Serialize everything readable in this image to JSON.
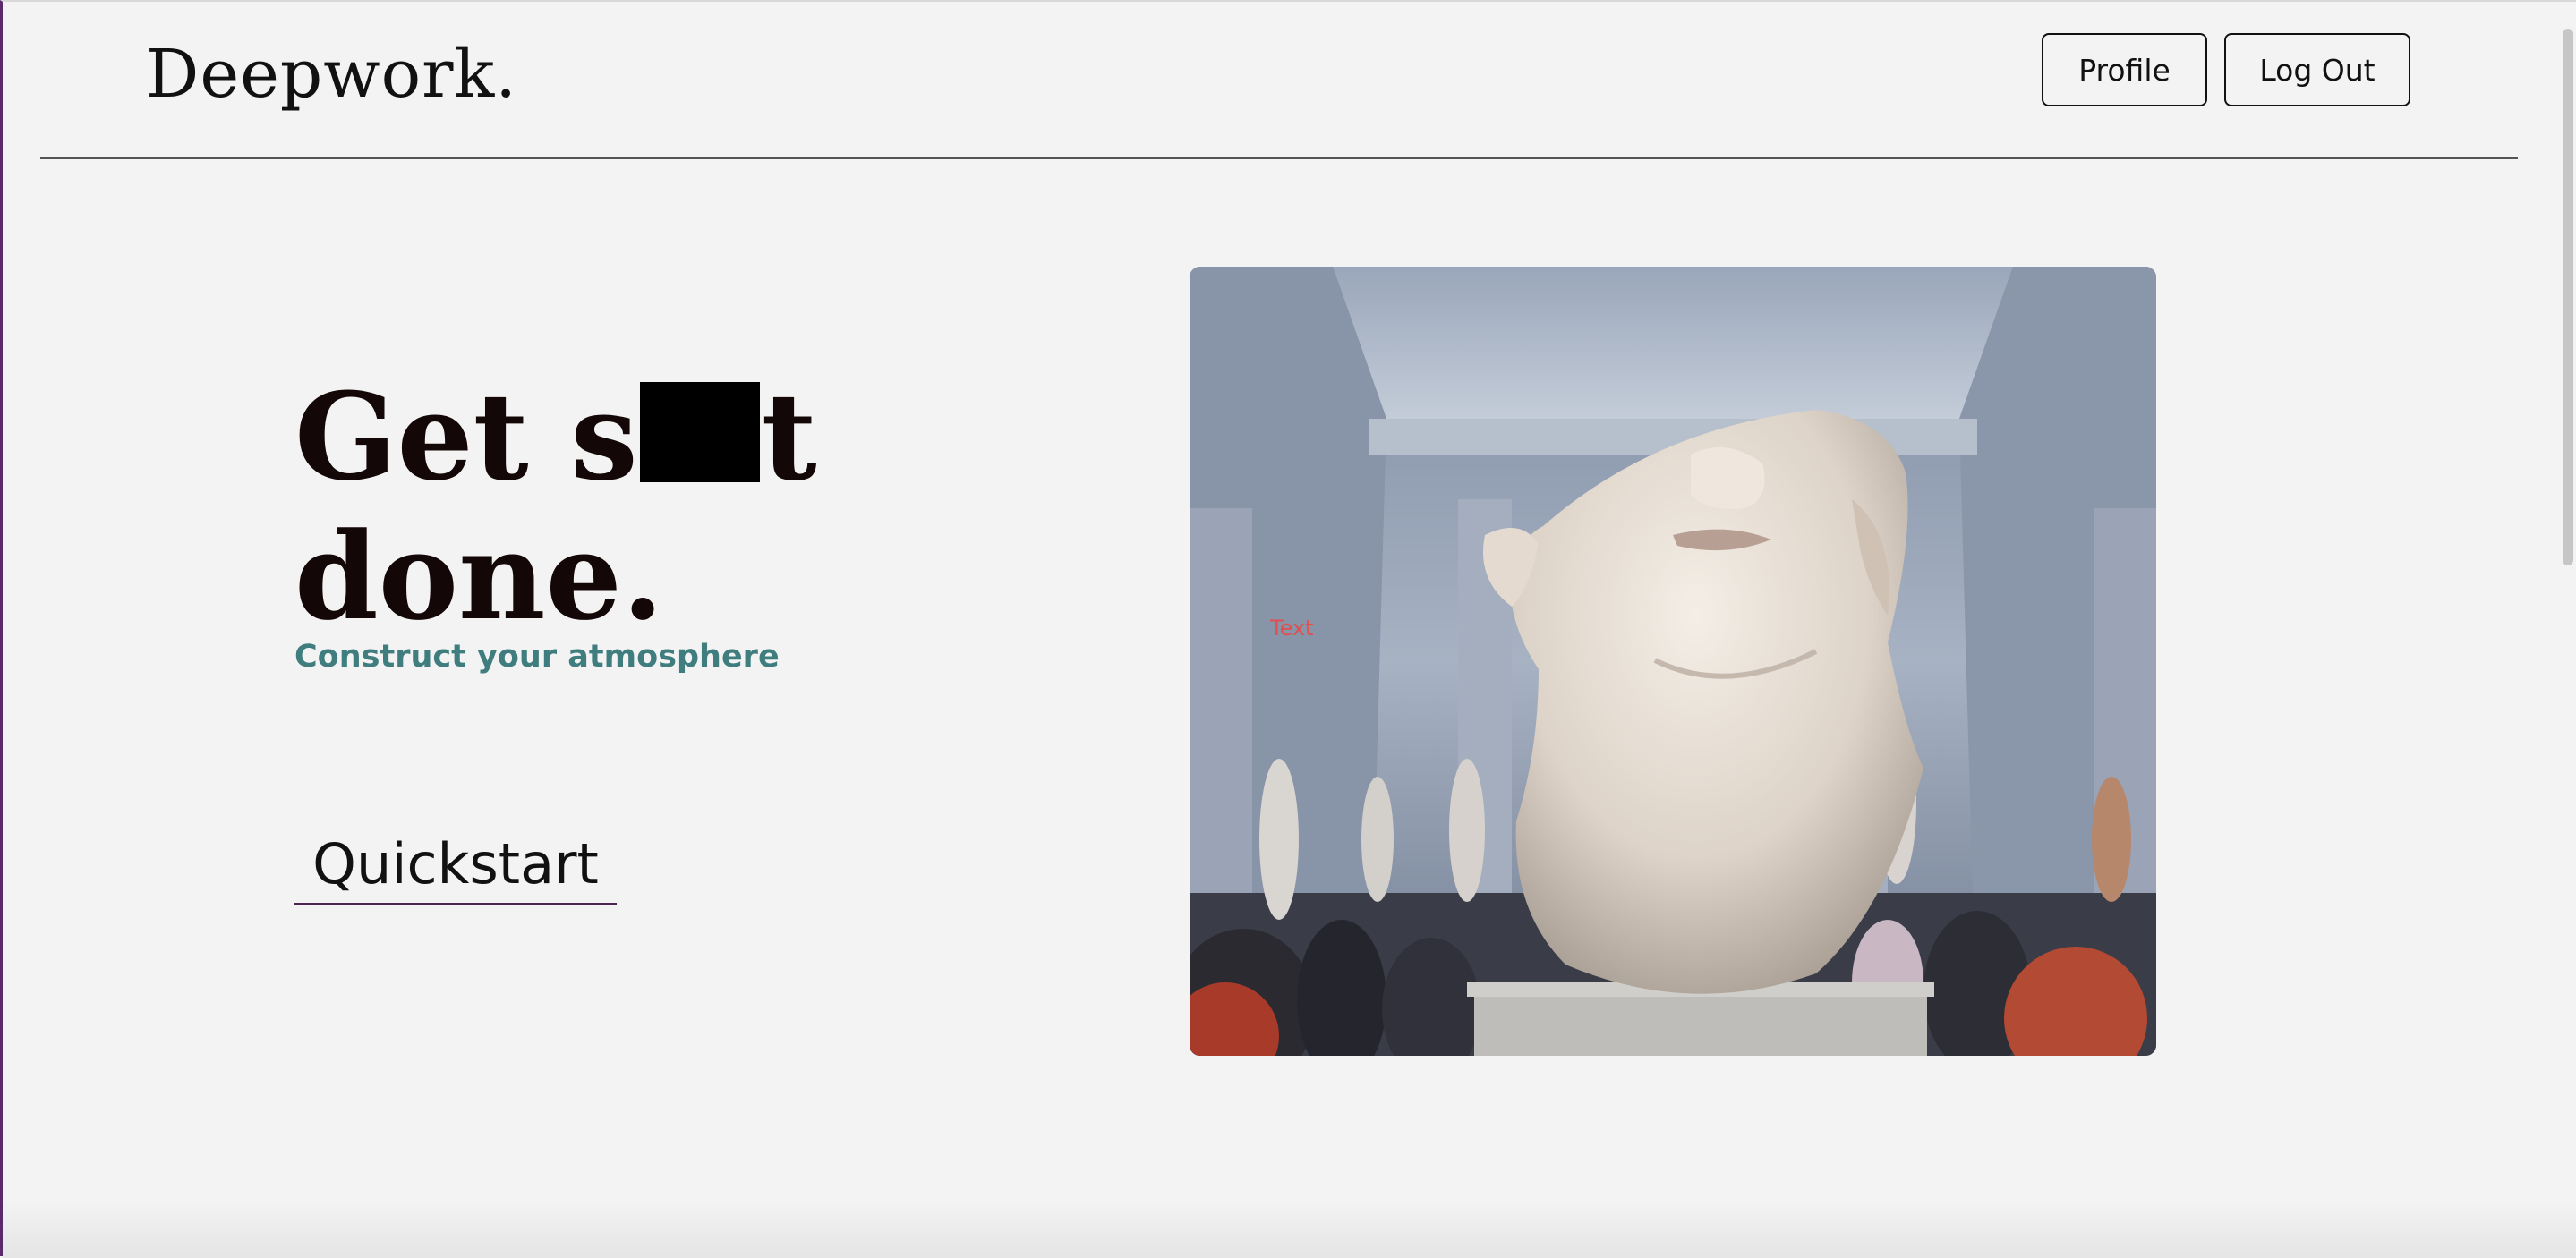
{
  "header": {
    "brand": "Deepwork.",
    "profile_label": "Profile",
    "logout_label": "Log Out"
  },
  "hero_text": {
    "headline_part1": "Get s",
    "headline_part2": "t",
    "headline_line2": "done.",
    "subtitle": "Construct your atmosphere",
    "quickstart_label": "Quickstart"
  },
  "hero_image": {
    "overlay_text": "Text",
    "icon": "marble-sculpture-image"
  },
  "colors": {
    "background": "#f3f3f3",
    "subtitle": "#3f7d7e",
    "headline": "#140707",
    "quickstart_underline": "#4a2650",
    "overlay_text": "#e05050"
  }
}
